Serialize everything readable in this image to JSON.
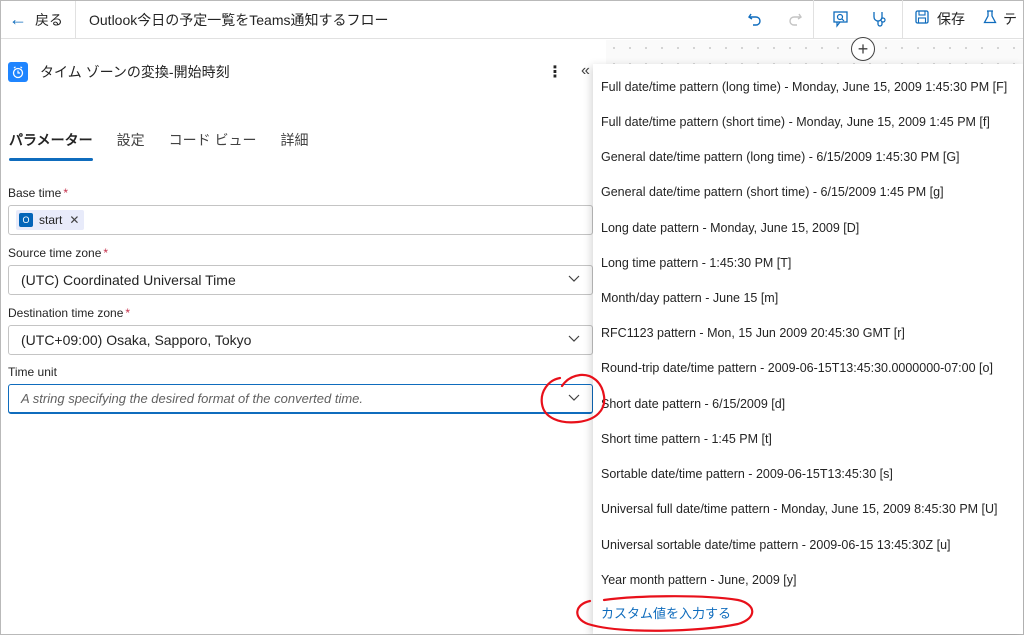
{
  "topbar": {
    "back_label": "戻る",
    "flow_title": "Outlook今日の予定一覧をTeams通知するフロー",
    "save_label": "保存",
    "test_label": "テ"
  },
  "action": {
    "title": "タイム ゾーンの変換-開始時刻"
  },
  "tabs": [
    {
      "label": "パラメーター",
      "active": true
    },
    {
      "label": "設定",
      "active": false
    },
    {
      "label": "コード ビュー",
      "active": false
    },
    {
      "label": "詳細",
      "active": false
    }
  ],
  "fields": {
    "base_time": {
      "label": "Base time",
      "required": "*",
      "token": "start"
    },
    "source_time_zone": {
      "label": "Source time zone",
      "required": "*",
      "value": "(UTC) Coordinated Universal Time"
    },
    "destination_time_zone": {
      "label": "Destination time zone",
      "required": "*",
      "value": "(UTC+09:00) Osaka, Sapporo, Tokyo"
    },
    "time_unit": {
      "label": "Time unit",
      "placeholder": "A string specifying the desired format of the converted time."
    }
  },
  "dropdown": {
    "options": [
      "Full date/time pattern (long time) - Monday, June 15, 2009 1:45:30 PM [F]",
      "Full date/time pattern (short time) - Monday, June 15, 2009 1:45 PM [f]",
      "General date/time pattern (long time) - 6/15/2009 1:45:30 PM [G]",
      "General date/time pattern (short time) - 6/15/2009 1:45 PM [g]",
      "Long date pattern - Monday, June 15, 2009 [D]",
      "Long time pattern - 1:45:30 PM [T]",
      "Month/day pattern - June 15 [m]",
      "RFC1123 pattern - Mon, 15 Jun 2009 20:45:30 GMT [r]",
      "Round-trip date/time pattern - 2009-06-15T13:45:30.0000000-07:00 [o]",
      "Short date pattern - 6/15/2009 [d]",
      "Short time pattern - 1:45 PM [t]",
      "Sortable date/time pattern - 2009-06-15T13:45:30 [s]",
      "Universal full date/time pattern - Monday, June 15, 2009 8:45:30 PM [U]",
      "Universal sortable date/time pattern - 2009-06-15 13:45:30Z [u]",
      "Year month pattern - June, 2009 [y]"
    ],
    "custom_label": "カスタム値を入力する"
  },
  "colors": {
    "accent": "#0f6cbd",
    "annotation": "#e8101a",
    "required": "#c4314b"
  }
}
